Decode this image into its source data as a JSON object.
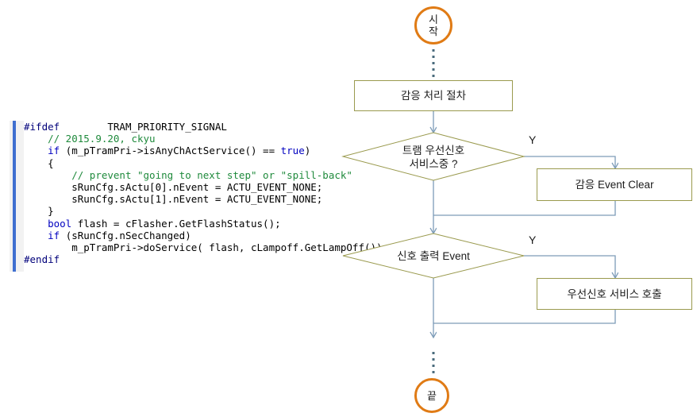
{
  "code_editor": {
    "language": "cpp",
    "lines": [
      {
        "indent": 0,
        "segments": [
          {
            "t": "#ifdef",
            "c": "pp"
          },
          {
            "t": "        TRAM_PRIORITY_SIGNAL",
            "c": "plain"
          }
        ]
      },
      {
        "indent": 1,
        "segments": [
          {
            "t": "// 2015.9.20, ckyu",
            "c": "cmt"
          }
        ]
      },
      {
        "indent": 1,
        "segments": [
          {
            "t": "if",
            "c": "kw"
          },
          {
            "t": " (m_pTramPri->isAnyChActService() == ",
            "c": "plain"
          },
          {
            "t": "true",
            "c": "kw"
          },
          {
            "t": ")",
            "c": "plain"
          }
        ]
      },
      {
        "indent": 1,
        "segments": [
          {
            "t": "{",
            "c": "plain"
          }
        ]
      },
      {
        "indent": 2,
        "segments": [
          {
            "t": "// prevent \"going to next step\" or \"spill-back\"",
            "c": "cmt"
          }
        ]
      },
      {
        "indent": 2,
        "segments": [
          {
            "t": "sRunCfg.sActu[0].nEvent = ACTU_EVENT_NONE;",
            "c": "plain"
          }
        ]
      },
      {
        "indent": 2,
        "segments": [
          {
            "t": "sRunCfg.sActu[1].nEvent = ACTU_EVENT_NONE;",
            "c": "plain"
          }
        ]
      },
      {
        "indent": 1,
        "segments": [
          {
            "t": "}",
            "c": "plain"
          }
        ]
      },
      {
        "indent": 1,
        "segments": [
          {
            "t": "bool",
            "c": "kw"
          },
          {
            "t": " flash = cFlasher.GetFlashStatus();",
            "c": "plain"
          }
        ]
      },
      {
        "indent": 1,
        "segments": [
          {
            "t": "if",
            "c": "kw"
          },
          {
            "t": " (sRunCfg.nSecChanged)",
            "c": "plain"
          }
        ]
      },
      {
        "indent": 2,
        "segments": [
          {
            "t": "m_pTramPri->doService( flash, cLampoff.GetLampOff());",
            "c": "plain"
          }
        ]
      },
      {
        "indent": 0,
        "segments": [
          {
            "t": "#endif",
            "c": "pp"
          }
        ]
      }
    ]
  },
  "flowchart": {
    "title": "",
    "colors": {
      "terminator_border": "#e07b15",
      "box_border": "#9a9a4e",
      "connector": "#8faec9",
      "dotted_connector": "#4a6b7c",
      "diamond_border": "#9a9a4e",
      "text": "#1b1b1b"
    },
    "nodes": {
      "start": {
        "type": "terminator",
        "label": "시\n작",
        "line1": "시",
        "line2": "작"
      },
      "process_top": {
        "type": "process",
        "label": "감응 처리 절차"
      },
      "decision_1": {
        "type": "decision",
        "line1": "트램 우선신호",
        "line2": "서비스중 ?"
      },
      "process_clear": {
        "type": "process",
        "label": "감응 Event Clear"
      },
      "decision_2": {
        "type": "decision",
        "line1": "신호 출력 Event",
        "line2": ""
      },
      "process_call": {
        "type": "process",
        "label": "우선신호 서비스 호출"
      },
      "end": {
        "type": "terminator",
        "label": "끝"
      }
    },
    "branch_labels": {
      "decision_1_yes": "Y",
      "decision_2_yes": "Y"
    }
  }
}
